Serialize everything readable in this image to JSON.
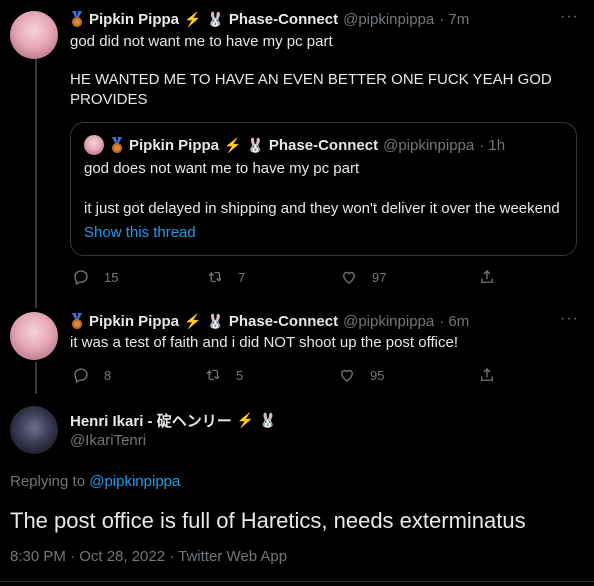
{
  "tweet1": {
    "name": "Pipkin Pippa",
    "affiliation": "Phase-Connect",
    "handle": "@pipkinpippa",
    "time": "· 7m",
    "line1": "god did not want me to have my pc part",
    "line2": "HE WANTED ME TO HAVE AN EVEN BETTER ONE FUCK YEAH GOD",
    "line3": "PROVIDES",
    "quote": {
      "name": "Pipkin Pippa",
      "affiliation": "Phase-Connect",
      "handle": "@pipkinpippa",
      "time": "· 1h",
      "line1": "god does not want me to have my pc part",
      "line2": "it just got delayed in shipping and they won't deliver it over the weekend",
      "link": "Show this thread"
    },
    "replies": "15",
    "retweets": "7",
    "likes": "97"
  },
  "tweet2": {
    "name": "Pipkin Pippa",
    "affiliation": "Phase-Connect",
    "handle": "@pipkinpippa",
    "time": "· 6m",
    "text": "it was a test of faith and i did NOT shoot up the post office!",
    "replies": "8",
    "retweets": "5",
    "likes": "95"
  },
  "main": {
    "name": "Henri Ikari - 碇ヘンリー",
    "handle": "@IkariTenri",
    "replying_prefix": "Replying to",
    "replying_to": "@pipkinpippa",
    "text": "The post office is full of Haretics, needs exterminatus",
    "meta": "8:30 PM · Oct 28, 2022 · Twitter Web App"
  },
  "icons": {
    "more": "more-icon",
    "reply": "reply-icon",
    "retweet": "retweet-icon",
    "like": "like-icon",
    "share": "share-icon"
  },
  "colors": {
    "background": "#000000",
    "link": "#1d9bf0",
    "muted": "#71767b",
    "text": "#e7e9ea"
  }
}
